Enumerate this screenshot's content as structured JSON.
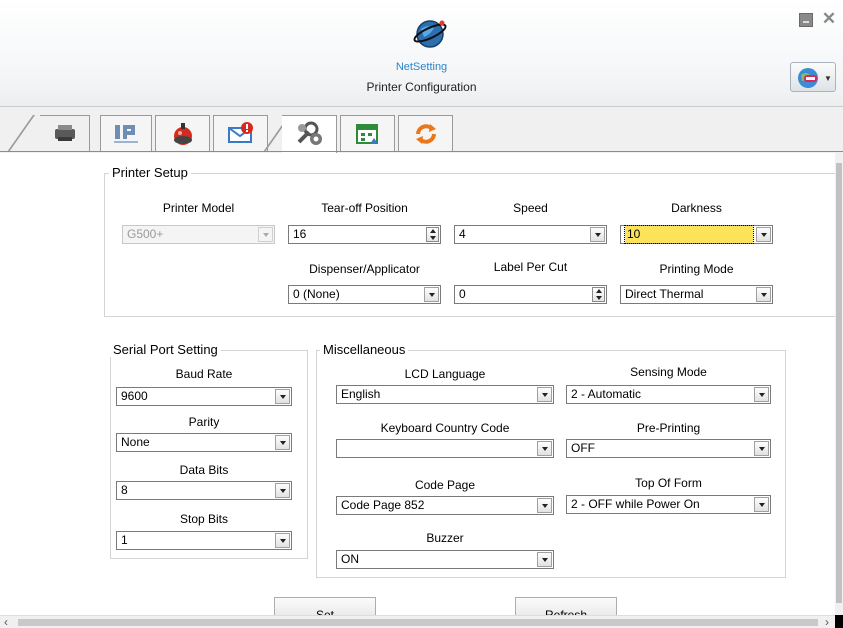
{
  "header": {
    "brand": "NetSetting",
    "subtitle": "Printer Configuration"
  },
  "tabs": [
    {
      "icon": "printer-icon"
    },
    {
      "icon": "ip-network-icon",
      "text": "IP"
    },
    {
      "icon": "alarm-bell-icon"
    },
    {
      "icon": "email-alert-icon"
    },
    {
      "icon": "printer-settings-icon",
      "active": true
    },
    {
      "icon": "rtc-clock-icon"
    },
    {
      "icon": "refresh-icon"
    }
  ],
  "printer_setup": {
    "title": "Printer Setup",
    "printer_model": {
      "label": "Printer Model",
      "value": "G500+"
    },
    "tear_off": {
      "label": "Tear-off  Position",
      "value": "16"
    },
    "speed": {
      "label": "Speed",
      "value": "4"
    },
    "darkness": {
      "label": "Darkness",
      "value": "10"
    },
    "dispenser": {
      "label": "Dispenser/Applicator",
      "value": "0 (None)"
    },
    "label_per_cut": {
      "label": "Label Per Cut",
      "value": "0"
    },
    "printing_mode": {
      "label": "Printing Mode",
      "value": "Direct Thermal"
    }
  },
  "serial": {
    "title": "Serial Port Setting",
    "baud_rate": {
      "label": "Baud Rate",
      "value": "9600"
    },
    "parity": {
      "label": "Parity",
      "value": "None"
    },
    "data_bits": {
      "label": "Data Bits",
      "value": "8"
    },
    "stop_bits": {
      "label": "Stop Bits",
      "value": "1"
    }
  },
  "misc": {
    "title": "Miscellaneous",
    "lcd_language": {
      "label": "LCD Language",
      "value": "English"
    },
    "sensing_mode": {
      "label": "Sensing Mode",
      "value": "2 - Automatic"
    },
    "keyboard_country": {
      "label": "Keyboard Country Code",
      "value": ""
    },
    "pre_printing": {
      "label": "Pre-Printing",
      "value": "OFF"
    },
    "code_page": {
      "label": "Code Page",
      "value": "Code Page 852"
    },
    "top_of_form": {
      "label": "Top Of Form",
      "value": "2 - OFF while Power On"
    },
    "buzzer": {
      "label": "Buzzer",
      "value": "ON"
    }
  },
  "buttons": {
    "set": "Set",
    "refresh": "Refresh"
  },
  "colors": {
    "brand": "#2d86c8",
    "highlight": "#fde35a"
  }
}
